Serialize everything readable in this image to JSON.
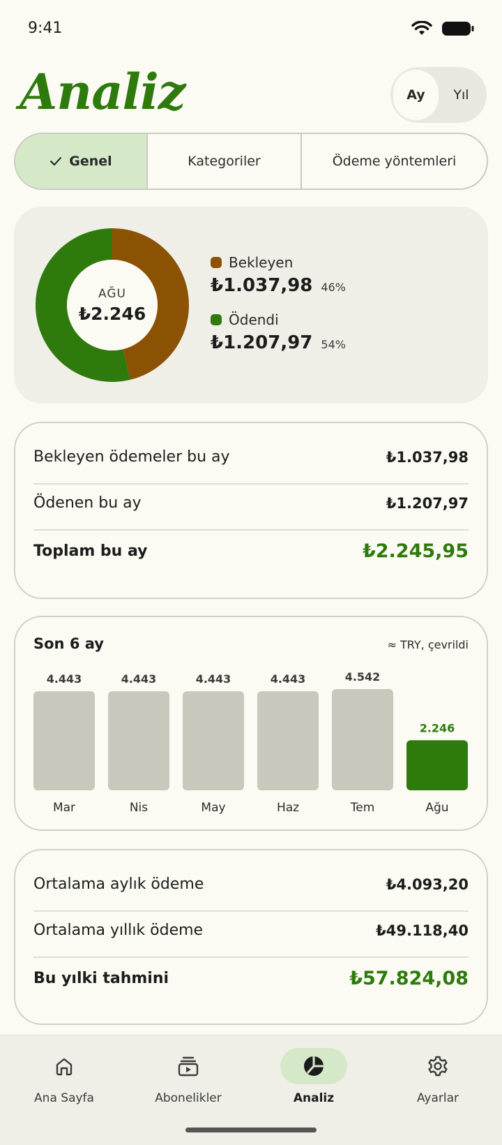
{
  "status": {
    "time": "9:41"
  },
  "header": {
    "title": "Analiz",
    "period_options": [
      "Ay",
      "Yıl"
    ],
    "period_selected": "Ay"
  },
  "tabs": [
    {
      "label": "Genel",
      "selected": true
    },
    {
      "label": "Kategoriler",
      "selected": false
    },
    {
      "label": "Ödeme yöntemleri",
      "selected": false
    }
  ],
  "summary": {
    "month_label": "AĞU",
    "total": "₺2.246",
    "segments": [
      {
        "label": "Bekleyen",
        "amount": "₺1.037,98",
        "percent": "46%",
        "fraction": 0.4622,
        "color": "#8b5204"
      },
      {
        "label": "Ödendi",
        "amount": "₺1.207,97",
        "percent": "54%",
        "fraction": 0.5378,
        "color": "#2e7a0c"
      }
    ]
  },
  "monthly": {
    "rows": [
      {
        "label": "Bekleyen ödemeler bu ay",
        "value": "₺1.037,98"
      },
      {
        "label": "Ödenen bu ay",
        "value": "₺1.207,97"
      },
      {
        "label": "Toplam bu ay",
        "value": "₺2.245,95"
      }
    ]
  },
  "chart_data": {
    "type": "bar",
    "title": "Son 6 ay",
    "note": "≈ TRY, çevrildi",
    "categories": [
      "Mar",
      "Nis",
      "May",
      "Haz",
      "Tem",
      "Ağu"
    ],
    "values": [
      4443,
      4443,
      4443,
      4443,
      4542,
      2246
    ],
    "value_labels": [
      "4.443",
      "4.443",
      "4.443",
      "4.443",
      "4.542",
      "2.246"
    ],
    "highlight_index": 5,
    "colors": {
      "default": "#c8c9bc",
      "highlight": "#2e7a0c",
      "highlight_label": "#2e7a0c"
    }
  },
  "averages": {
    "rows": [
      {
        "label": "Ortalama aylık ödeme",
        "value": "₺4.093,20"
      },
      {
        "label": "Ortalama yıllık ödeme",
        "value": "₺49.118,40"
      },
      {
        "label": "Bu yılki tahmini",
        "value": "₺57.824,08"
      }
    ]
  },
  "nav": [
    {
      "label": "Ana Sayfa",
      "icon": "home-icon",
      "active": false
    },
    {
      "label": "Abonelikler",
      "icon": "subscriptions-icon",
      "active": false
    },
    {
      "label": "Analiz",
      "icon": "analytics-pie-icon",
      "active": true
    },
    {
      "label": "Ayarlar",
      "icon": "gear-icon",
      "active": false
    }
  ],
  "colors": {
    "accent": "#2e7a0c",
    "pending": "#8b5204",
    "accent_soft": "#d5e8c8"
  }
}
